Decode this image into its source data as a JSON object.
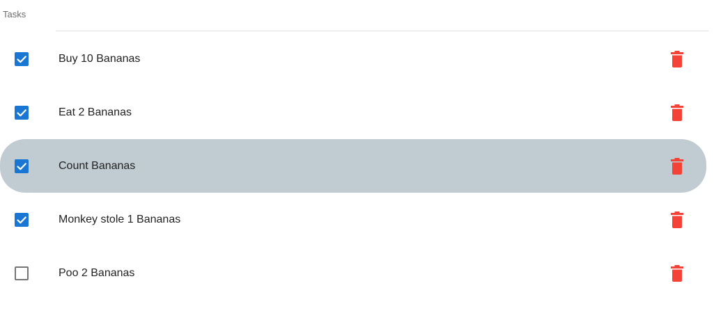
{
  "header": {
    "title": "Tasks"
  },
  "colors": {
    "accent": "#1976d2",
    "delete": "#f44336",
    "selected_row": "#c0cbd2"
  },
  "tasks": [
    {
      "label": "Buy 10 Bananas",
      "checked": true,
      "selected": false,
      "delete_icon": "trash-icon"
    },
    {
      "label": "Eat 2 Bananas",
      "checked": true,
      "selected": false,
      "delete_icon": "trash-icon"
    },
    {
      "label": "Count Bananas",
      "checked": true,
      "selected": true,
      "delete_icon": "trash-icon"
    },
    {
      "label": "Monkey stole 1 Bananas",
      "checked": true,
      "selected": false,
      "delete_icon": "trash-icon"
    },
    {
      "label": "Poo 2 Bananas",
      "checked": false,
      "selected": false,
      "delete_icon": "trash-icon"
    }
  ]
}
